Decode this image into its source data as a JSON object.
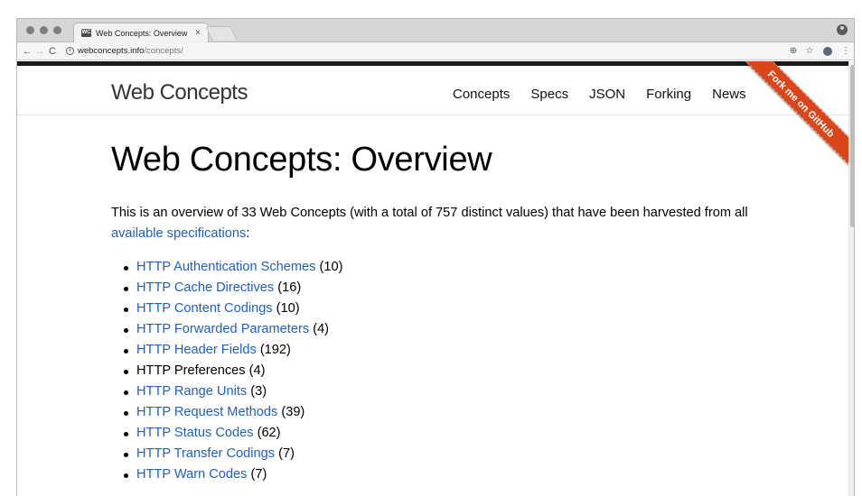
{
  "browser": {
    "tab_title": "Web Concepts: Overview",
    "tab_favicon": "WC",
    "tab_close": "×",
    "url_host": "webconcepts.info",
    "url_path": "/concepts/",
    "icons": [
      "back-arrow-icon",
      "forward-arrow-icon",
      "reload-icon",
      "info-icon",
      "zoom-icon",
      "bookmark-star-icon",
      "extension-icon",
      "menu-icon",
      "profile-icon"
    ]
  },
  "site": {
    "logo": "Web Concepts",
    "nav": [
      "Concepts",
      "Specs",
      "JSON",
      "Forking",
      "News"
    ],
    "ribbon": "Fork me on GitHub"
  },
  "main": {
    "title": "Web Concepts: Overview",
    "intro_prefix": "This is an overview of 33 Web Concepts (with a total of 757 distinct values) that have been harvested from all ",
    "intro_link": "available specifications",
    "intro_suffix": ":",
    "items": [
      {
        "label": "HTTP Authentication Schemes",
        "count": "(10)",
        "link": true
      },
      {
        "label": "HTTP Cache Directives",
        "count": "(16)",
        "link": true
      },
      {
        "label": "HTTP Content Codings",
        "count": "(10)",
        "link": true
      },
      {
        "label": "HTTP Forwarded Parameters",
        "count": "(4)",
        "link": true
      },
      {
        "label": "HTTP Header Fields",
        "count": "(192)",
        "link": true
      },
      {
        "label": "HTTP Preferences",
        "count": "(4)",
        "link": false
      },
      {
        "label": "HTTP Range Units",
        "count": "(3)",
        "link": true
      },
      {
        "label": "HTTP Request Methods",
        "count": "(39)",
        "link": true
      },
      {
        "label": "HTTP Status Codes",
        "count": "(62)",
        "link": true
      },
      {
        "label": "HTTP Transfer Codings",
        "count": "(7)",
        "link": true
      },
      {
        "label": "HTTP Warn Codes",
        "count": "(7)",
        "link": true
      }
    ]
  },
  "colors": {
    "link": "#1f5fc2",
    "ribbon": "#d8461a",
    "topbar": "#1a1a1a"
  }
}
